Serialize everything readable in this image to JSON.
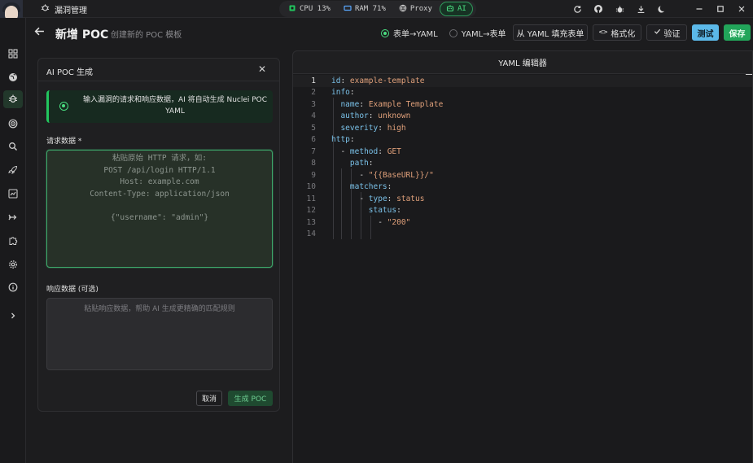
{
  "titlebar": {
    "module": "漏洞管理",
    "pills": [
      {
        "label": "CPU 13%",
        "icon": "cpu-icon"
      },
      {
        "label": "RAM 71%",
        "icon": "memory-icon"
      },
      {
        "label": "Proxy",
        "icon": "globe-icon"
      },
      {
        "label": "AI",
        "icon": "bot-icon"
      }
    ]
  },
  "header": {
    "title": "新增 POC",
    "subtitle": "创建新的 POC 模板",
    "mode_form_to_yaml": "表单→YAML",
    "mode_yaml_to_form": "YAML→表单",
    "fill_from_yaml": "从 YAML 填充表单",
    "format": "格式化",
    "validate": "验证",
    "test": "测试",
    "save": "保存"
  },
  "ai_panel": {
    "title": "AI POC 生成",
    "info": "输入漏洞的请求和响应数据，AI 将自动生成 Nuclei POC YAML",
    "request_label": "请求数据 *",
    "request_placeholder": "粘贴原始 HTTP 请求，如:\nPOST /api/login HTTP/1.1\nHost: example.com\nContent-Type: application/json\n\n{\"username\": \"admin\"}",
    "response_label": "响应数据 (可选)",
    "response_placeholder": "粘贴响应数据，帮助 AI 生成更精确的匹配规则",
    "cancel": "取消",
    "generate": "生成 POC"
  },
  "editor": {
    "title": "YAML 编辑器",
    "lines": [
      {
        "n": "1",
        "k": "id",
        "v": "example-template"
      },
      {
        "n": "2",
        "k": "info",
        "v": ""
      },
      {
        "n": "3",
        "k": "name",
        "v": "Example Template"
      },
      {
        "n": "4",
        "k": "author",
        "v": "unknown"
      },
      {
        "n": "5",
        "k": "severity",
        "v": "high"
      },
      {
        "n": "6",
        "k": "http",
        "v": ""
      },
      {
        "n": "7",
        "k": "method",
        "v": "GET"
      },
      {
        "n": "8",
        "k": "path",
        "v": ""
      },
      {
        "n": "9",
        "k": "",
        "v": "\"{{BaseURL}}/\""
      },
      {
        "n": "10",
        "k": "matchers",
        "v": ""
      },
      {
        "n": "11",
        "k": "type",
        "v": "status"
      },
      {
        "n": "12",
        "k": "status",
        "v": ""
      },
      {
        "n": "13",
        "k": "",
        "v": "\"200\""
      },
      {
        "n": "14",
        "k": "",
        "v": ""
      }
    ]
  },
  "colors": {
    "accent_green": "#22a55a",
    "test_blue": "#5bb8e8",
    "yaml_key": "#7ac1e8",
    "yaml_value": "#e0a07a"
  }
}
